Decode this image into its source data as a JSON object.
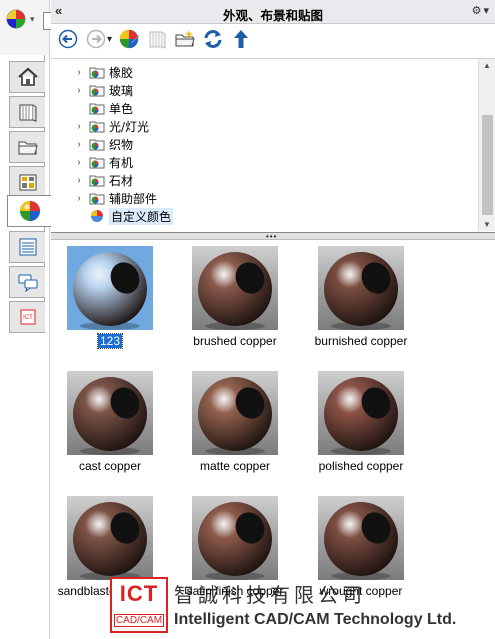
{
  "panel": {
    "title": "外观、布景和贴图",
    "collapse_label": "«",
    "options_label": "⚙",
    "options_caret": "▾"
  },
  "toolbar": {
    "buttons": [
      {
        "name": "back-button",
        "icon": "back-arrow-icon"
      },
      {
        "name": "forward-button",
        "icon": "forward-arrow-icon"
      },
      {
        "name": "appearance-dropdown",
        "icon": "appearance-ball-icon"
      },
      {
        "name": "copy-appearance-button",
        "icon": "book-icon"
      },
      {
        "name": "add-folder-button",
        "icon": "new-folder-icon"
      },
      {
        "name": "refresh-button",
        "icon": "refresh-icon"
      },
      {
        "name": "up-button",
        "icon": "up-arrow-icon"
      }
    ],
    "dropdown_caret": "▾"
  },
  "tree": {
    "items": [
      {
        "label": "橡胶",
        "expandable": true
      },
      {
        "label": "玻璃",
        "expandable": true
      },
      {
        "label": "单色",
        "expandable": false
      },
      {
        "label": "光/灯光",
        "expandable": true
      },
      {
        "label": "织物",
        "expandable": true
      },
      {
        "label": "有机",
        "expandable": true
      },
      {
        "label": "石材",
        "expandable": true
      },
      {
        "label": "辅助部件",
        "expandable": true
      },
      {
        "label": "自定义颜色",
        "expandable": false,
        "selected": true
      }
    ],
    "arrow": "›"
  },
  "splitter": {
    "grip": "•••"
  },
  "gallery": {
    "items": [
      {
        "label": "123",
        "selected": true,
        "color": "#b8d2ee"
      },
      {
        "label": "brushed copper",
        "selected": false,
        "color": "#8a5a4c"
      },
      {
        "label": "burnished copper",
        "selected": false,
        "color": "#7a4d3f"
      },
      {
        "label": "cast copper",
        "selected": false,
        "color": "#7c5448"
      },
      {
        "label": "matte copper",
        "selected": false,
        "color": "#93624f"
      },
      {
        "label": "polished copper",
        "selected": false,
        "color": "#8b5346"
      },
      {
        "label": "sandblasted copper",
        "selected": false,
        "color": "#7e5447"
      },
      {
        "label": "satin finish copper",
        "selected": false,
        "color": "#8d5b4b"
      },
      {
        "label": "wrought copper",
        "selected": false,
        "color": "#7d4f43"
      }
    ]
  },
  "sidetabs": [
    {
      "name": "tab-home",
      "icon": "home-icon"
    },
    {
      "name": "tab-library",
      "icon": "library-icon"
    },
    {
      "name": "tab-file-explorer",
      "icon": "folder-icon"
    },
    {
      "name": "tab-view-palette",
      "icon": "palette-icon"
    },
    {
      "name": "tab-appearances",
      "icon": "appearance-ball-icon"
    },
    {
      "name": "tab-custom-properties",
      "icon": "list-icon"
    },
    {
      "name": "tab-forum",
      "icon": "chat-icon"
    },
    {
      "name": "tab-ict",
      "icon": "ict-icon"
    }
  ],
  "watermark": {
    "logo_text": "ICT",
    "logo_sub": "CAD/CAM",
    "cn_text": "智誠科技有限公司",
    "en_text": "Intelligent CAD/CAM Technology Ltd."
  },
  "colors": {
    "selection_blue": "#1a6fd6",
    "copper": "#8a5a4c"
  }
}
